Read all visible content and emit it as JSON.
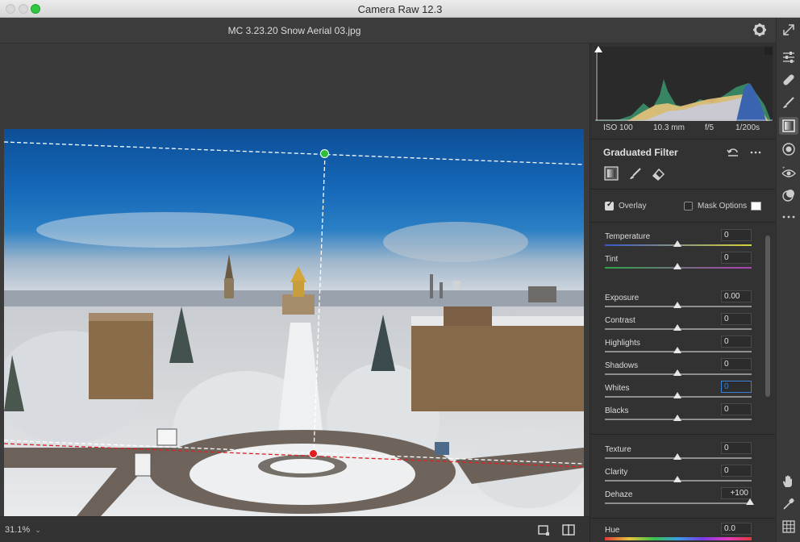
{
  "window": {
    "title": "Camera Raw 12.3"
  },
  "file": {
    "name": "MC 3.23.20 Snow Aerial 03.jpg"
  },
  "exif": {
    "iso": "ISO 100",
    "focal": "10.3 mm",
    "aperture": "f/5",
    "shutter": "1/200s"
  },
  "panel": {
    "title": "Graduated Filter",
    "overlay_label": "Overlay",
    "overlay_checked": true,
    "mask_options_label": "Mask Options",
    "mask_options_checked": false
  },
  "sliders": [
    {
      "label": "Temperature",
      "value": "0"
    },
    {
      "label": "Tint",
      "value": "0"
    },
    {
      "label": "Exposure",
      "value": "0.00"
    },
    {
      "label": "Contrast",
      "value": "0"
    },
    {
      "label": "Highlights",
      "value": "0"
    },
    {
      "label": "Shadows",
      "value": "0"
    },
    {
      "label": "Whites",
      "value": "0"
    },
    {
      "label": "Blacks",
      "value": "0"
    },
    {
      "label": "Texture",
      "value": "0"
    },
    {
      "label": "Clarity",
      "value": "0"
    },
    {
      "label": "Dehaze",
      "value": "+100"
    },
    {
      "label": "Hue",
      "value": "0.0"
    }
  ],
  "zoom": {
    "value": "31.1%"
  },
  "colors": {
    "accent": "#3b7fd8",
    "green_pin": "#2fbf3a",
    "red_pin": "#e02020"
  },
  "icons": [
    "gear-icon",
    "fullscreen-icon",
    "edit-sliders-icon",
    "healing-icon",
    "brush-icon",
    "graduated-filter-icon",
    "radial-filter-icon",
    "redeye-icon",
    "presets-icon",
    "more-icon",
    "hand-icon",
    "eyedropper-icon",
    "grid-icon"
  ]
}
